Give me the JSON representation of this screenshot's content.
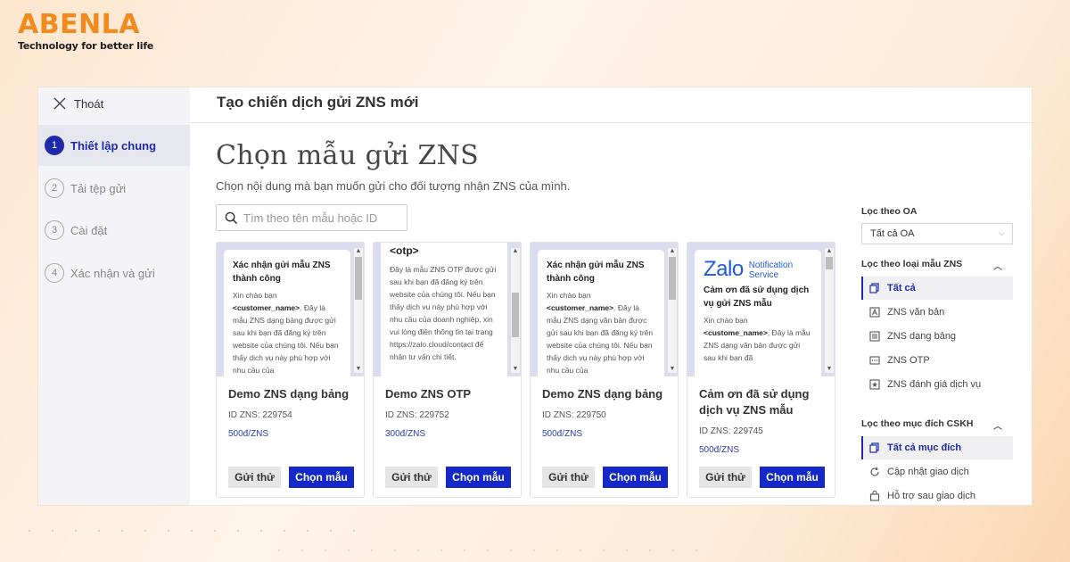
{
  "brand": {
    "name": "ABENLA",
    "tagline": "Technology for better life"
  },
  "sidebar": {
    "exit_label": "Thoát",
    "steps": [
      {
        "num": "1",
        "label": "Thiết lập chung"
      },
      {
        "num": "2",
        "label": "Tải tệp gửi"
      },
      {
        "num": "3",
        "label": "Cài đặt"
      },
      {
        "num": "4",
        "label": "Xác nhận và gửi"
      }
    ]
  },
  "header": {
    "title": "Tạo chiến dịch gửi ZNS mới"
  },
  "main": {
    "title": "Chọn mẫu gửi ZNS",
    "subtitle": "Chọn nội dung mà bạn muốn gửi cho đối tượng nhận ZNS của mình.",
    "search_placeholder": "Tìm theo tên mẫu hoặc ID"
  },
  "cards": [
    {
      "preview_title": "Xác nhận gửi mẫu ZNS thành công",
      "preview_greeting": "Xin chào bạn",
      "preview_var": "<customer_name>",
      "preview_body": ". Đây là mẫu ZNS dạng bảng được gửi sau khi bạn đã đăng ký trên website của chúng tôi. Nếu bạn thấy dịch vụ này phù hợp với nhu cầu của",
      "name": "Demo ZNS dạng bảng",
      "id_text": "ID ZNS: 229754",
      "price": "500đ/ZNS",
      "test_label": "Gửi thử",
      "choose_label": "Chọn mẫu"
    },
    {
      "preview_title": "<otp>",
      "preview_body": "Đây là mẫu ZNS OTP được gửi sau khi bạn đã đăng ký trên website của chúng tôi. Nếu bạn thấy dịch vụ này phù hợp với nhu cầu của doanh nghiệp, xin vui lòng điền thông tin tại trang https://zalo.cloud/contact để nhận tư vấn chi tiết.",
      "name": "Demo ZNS OTP",
      "id_text": "ID ZNS: 229752",
      "price": "300đ/ZNS",
      "test_label": "Gửi thử",
      "choose_label": "Chọn mẫu"
    },
    {
      "preview_title": "Xác nhận gửi mẫu ZNS thành công",
      "preview_greeting": "Xin chào bạn",
      "preview_var": "<customer_name>",
      "preview_body": ". Đây là mẫu ZNS dạng văn bản được gửi sau khi bạn đã đăng ký trên website của chúng tôi. Nếu bạn thấy dịch vụ này phù hợp với nhu cầu của",
      "name": "Demo ZNS dạng bảng",
      "id_text": "ID ZNS: 229750",
      "price": "500đ/ZNS",
      "test_label": "Gửi thử",
      "choose_label": "Chọn mẫu"
    },
    {
      "logo_word": "Zalo",
      "logo_service_1": "Notification",
      "logo_service_2": "Service",
      "preview_title": "Cảm ơn đã sử dụng dịch vụ gửi ZNS mẫu",
      "preview_greeting": "Xin chào bạn",
      "preview_var": "<custome_name>",
      "preview_body": ", Đây là mẫu ZNS dạng văn bản được gửi sau khi bạn đã",
      "name": "Cảm ơn đã sử dụng dịch vụ ZNS mẫu",
      "id_text": "ID ZNS: 229745",
      "price": "500đ/ZNS",
      "test_label": "Gửi thử",
      "choose_label": "Chọn mẫu"
    }
  ],
  "filters": {
    "oa_label": "Lọc theo OA",
    "oa_value": "Tất cả OA",
    "type_label": "Lọc theo loại mẫu ZNS",
    "types": [
      "Tất cả",
      "ZNS văn bản",
      "ZNS dạng bảng",
      "ZNS OTP",
      "ZNS đánh giá dịch vụ"
    ],
    "purpose_label": "Lọc theo mục đích CSKH",
    "purposes": [
      "Tất cả mục đích",
      "Cập nhật giao dịch",
      "Hỗ trợ sau giao dịch"
    ]
  },
  "colors": {
    "accent": "#1427c9",
    "brand": "#f28a1e",
    "preview_bg": "#dcdcef"
  }
}
